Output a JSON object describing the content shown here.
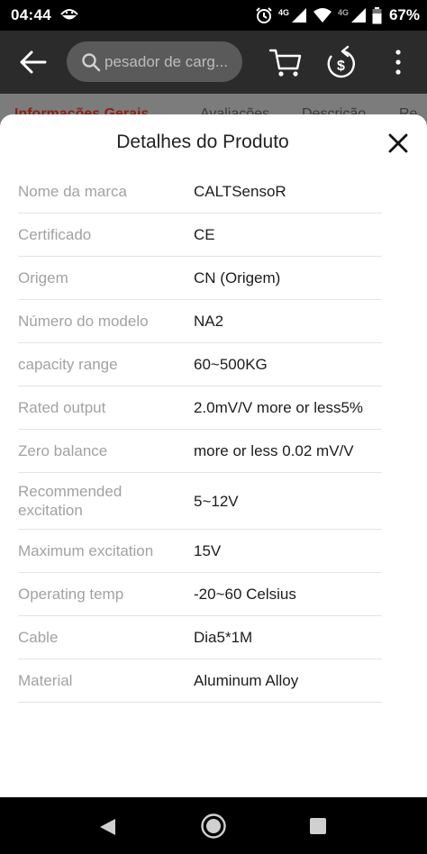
{
  "status_bar": {
    "time": "04:44",
    "network_label": "4G",
    "network_label_2": "4G",
    "battery": "67%"
  },
  "app_bar": {
    "search_placeholder": "pesador de carg...",
    "icons": [
      "back-arrow-icon",
      "search-icon",
      "cart-icon",
      "coin-refresh-icon",
      "more-vert-icon"
    ]
  },
  "tabs": [
    {
      "label": "Informações Gerais",
      "active": true
    },
    {
      "label": "Avaliações",
      "active": false
    },
    {
      "label": "Descrição",
      "active": false
    },
    {
      "label": "Re",
      "active": false
    }
  ],
  "sheet": {
    "title": "Detalhes do Produto",
    "specs": [
      {
        "label": "Nome da marca",
        "value": "CALTSensoR"
      },
      {
        "label": "Certificado",
        "value": "CE"
      },
      {
        "label": "Origem",
        "value": "CN (Origem)"
      },
      {
        "label": "Número do modelo",
        "value": "NA2"
      },
      {
        "label": "capacity range",
        "value": "60~500KG"
      },
      {
        "label": "Rated output",
        "value": "2.0mV/V more or less5%"
      },
      {
        "label": "Zero balance",
        "value": "more or less 0.02 mV/V"
      },
      {
        "label": "Recommended excitation",
        "value": "5~12V"
      },
      {
        "label": "Maximum excitation",
        "value": "15V"
      },
      {
        "label": "Operating temp",
        "value": "-20~60 Celsius"
      },
      {
        "label": "Cable",
        "value": "Dia5*1M"
      },
      {
        "label": "Material",
        "value": "Aluminum Alloy"
      }
    ]
  },
  "colors": {
    "app_bar": "#2b2b2b",
    "active_tab": "#8c1f13",
    "label_gray": "#a2a2a2",
    "value_dark": "#1c1c1c"
  }
}
